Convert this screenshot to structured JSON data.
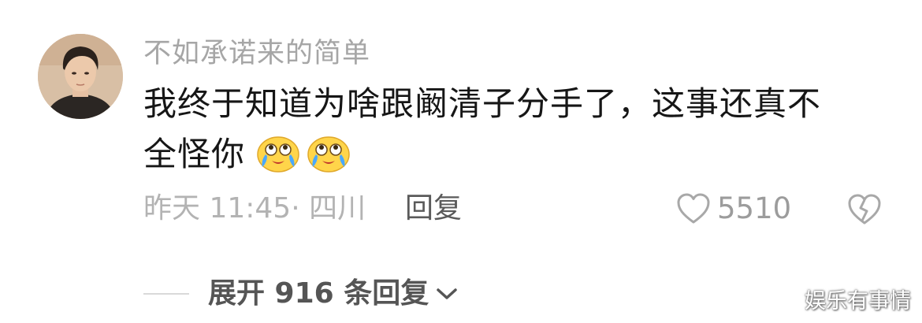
{
  "comment": {
    "username": "不如承诺来的简单",
    "text_line1": "我终于知道为啥跟阚清子分手了，这事还真不",
    "text_line2": "全怪你",
    "emojis": [
      "tears-of-joy-emoji",
      "tears-of-joy-emoji"
    ],
    "meta": "昨天 11:45· 四川",
    "reply_label": "回复",
    "like_count": "5510",
    "like_icon": "heart-outline-icon",
    "dislike_icon": "broken-heart-icon"
  },
  "replies": {
    "expand_label": "展开 916 条回复",
    "expand_icon": "chevron-down-icon"
  },
  "watermark": "娱乐有事情",
  "colors": {
    "username": "#a6a6a6",
    "text": "#161616",
    "meta": "#b3b3b3",
    "reply": "#5a5a5a",
    "emoji_face": "#ffd54a",
    "emoji_tears": "#4aa8ff"
  }
}
